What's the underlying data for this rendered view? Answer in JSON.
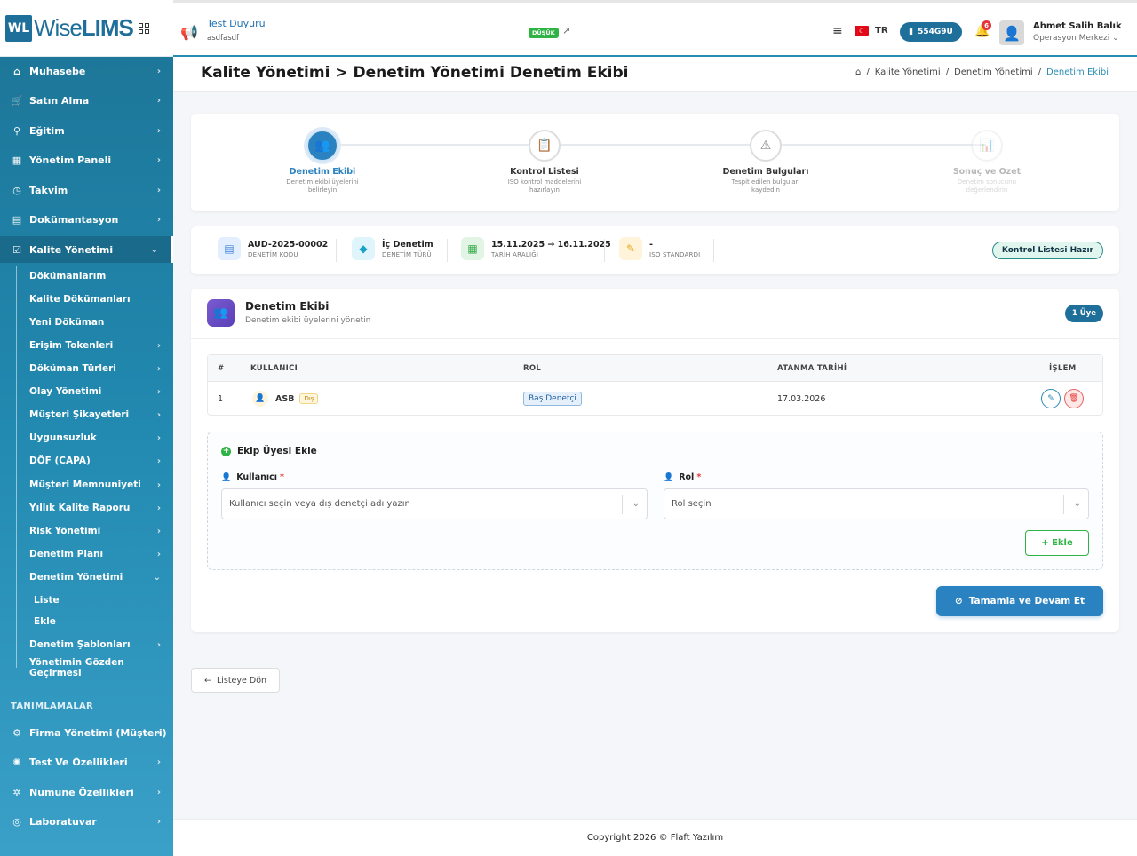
{
  "brand": {
    "badge": "WL",
    "name_light": "Wise",
    "name_bold": "LIMS"
  },
  "header": {
    "announcement_title": "Test Duyuru",
    "announcement_sub": "asdfasdf",
    "priority": "DÜŞÜK",
    "link_icon": "↗",
    "lang": "TR",
    "code": "554G9U",
    "notifications": "6",
    "user_name": "Ahmet Salih Balık",
    "user_role": "Operasyon Merkezi ⌄"
  },
  "sidebar": {
    "top_items": [
      {
        "label": "Muhasebe",
        "icon": "calculator-icon"
      },
      {
        "label": "Satın Alma",
        "icon": "cart-icon"
      },
      {
        "label": "Eğitim",
        "icon": "search-icon"
      },
      {
        "label": "Yönetim Paneli",
        "icon": "calendar-icon"
      },
      {
        "label": "Takvim",
        "icon": "dashboard-icon"
      },
      {
        "label": "Dokümantasyon",
        "icon": "document-icon"
      },
      {
        "label": "Kalite Yönetimi",
        "icon": "quality-icon"
      }
    ],
    "sub_items": [
      {
        "label": "Dökümanlarım",
        "chev": ""
      },
      {
        "label": "Kalite Dökümanları",
        "chev": ""
      },
      {
        "label": "Yeni Döküman",
        "chev": ""
      },
      {
        "label": "Erişim Tokenleri",
        "chev": "›"
      },
      {
        "label": "Döküman Türleri",
        "chev": "›"
      },
      {
        "label": "Olay Yönetimi",
        "chev": "›"
      },
      {
        "label": "Müşteri Şikayetleri",
        "chev": "›"
      },
      {
        "label": "Uygunsuzluk",
        "chev": "›"
      },
      {
        "label": "DÖF (CAPA)",
        "chev": "›"
      },
      {
        "label": "Müşteri Memnuniyeti",
        "chev": "›"
      },
      {
        "label": "Yıllık Kalite Raporu",
        "chev": "›"
      },
      {
        "label": "Risk Yönetimi",
        "chev": "›"
      },
      {
        "label": "Denetim Planı",
        "chev": "›"
      },
      {
        "label": "Denetim Yönetimi",
        "chev": "⌄"
      },
      {
        "label": "Liste",
        "chev": ""
      },
      {
        "label": "Ekle",
        "chev": ""
      },
      {
        "label": "Denetim Şablonları",
        "chev": "›"
      },
      {
        "label": "Yönetimin Gözden Geçirmesi",
        "chev": ""
      }
    ],
    "section_label": "TANIMLAMALAR",
    "bottom_items": [
      {
        "label": "Firma Yönetimi (Müşteri)",
        "icon": "company-icon"
      },
      {
        "label": "Test Ve Özellikleri",
        "icon": "test-icon"
      },
      {
        "label": "Numune Özellikleri",
        "icon": "sample-icon"
      },
      {
        "label": "Laboratuvar",
        "icon": "lab-icon"
      }
    ]
  },
  "page": {
    "title": "Kalite Yönetimi > Denetim Yönetimi Denetim Ekibi",
    "breadcrumb": [
      "Kalite Yönetimi",
      "Denetim Yönetimi",
      "Denetim Ekibi"
    ]
  },
  "steps": [
    {
      "title": "Denetim Ekibi",
      "desc": "Denetim ekibi üyelerini belirleyin",
      "icon": "👥"
    },
    {
      "title": "Kontrol Listesi",
      "desc": "ISO kontrol maddelerini hazırlayın",
      "icon": "📋"
    },
    {
      "title": "Denetim Bulguları",
      "desc": "Tespit edilen bulguları kaydedin",
      "icon": "⚠"
    },
    {
      "title": "Sonuç ve Özet",
      "desc": "Denetim sonucunu değerlendirin",
      "icon": "📊"
    }
  ],
  "info": {
    "code_value": "AUD-2025-00002",
    "code_label": "DENETİM KODU",
    "type_value": "İç Denetim",
    "type_label": "DENETİM TÜRÜ",
    "date_value": "15.11.2025 → 16.11.2025",
    "date_label": "TARİH ARALIĞI",
    "iso_value": "-",
    "iso_label": "ISO STANDARDI",
    "status": "Kontrol Listesi Hazır"
  },
  "team": {
    "title": "Denetim Ekibi",
    "subtitle": "Denetim ekibi üyelerini yönetin",
    "count": "1 Üye",
    "columns": {
      "no": "#",
      "user": "KULLANICI",
      "role": "ROL",
      "date": "ATANMA TARİHİ",
      "action": "İŞLEM"
    },
    "rows": [
      {
        "no": "1",
        "user": "ASB",
        "tag": "Dış",
        "role": "Baş Denetçi",
        "date": "17.03.2026"
      }
    ]
  },
  "add_form": {
    "title": "Ekip Üyesi Ekle",
    "user_label": "Kullanıcı",
    "user_placeholder": "Kullanıcı seçin veya dış denetçi adı yazın",
    "role_label": "Rol",
    "role_placeholder": "Rol seçin",
    "required": "*",
    "add_button": "+ Ekle"
  },
  "actions": {
    "complete": "Tamamla ve Devam Et",
    "back": "Listeye Dön"
  },
  "footer": "Copyright 2026 © Flaft Yazılım"
}
